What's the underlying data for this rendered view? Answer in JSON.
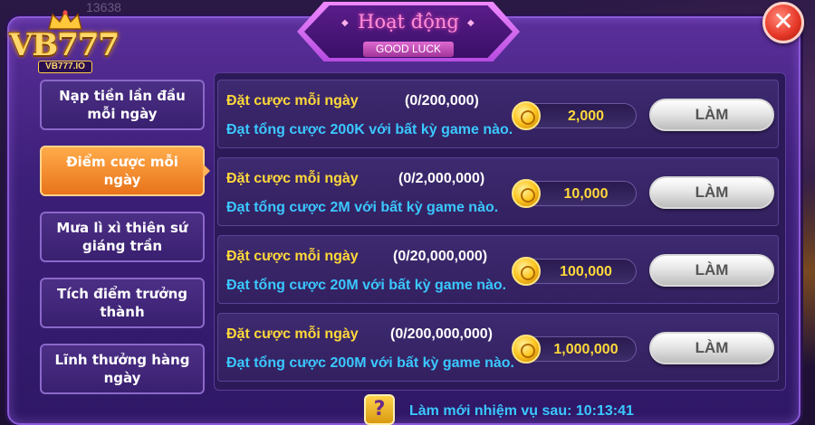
{
  "header": {
    "title": "Hoạt động",
    "subtitle": "GOOD LUCK",
    "close_label": "✕"
  },
  "logo": {
    "text": "VB777",
    "sub": "VB777.IO"
  },
  "background": {
    "top_text": "13638"
  },
  "sidebar": {
    "items": [
      {
        "label": "Nạp tiền lần đầu mỗi ngày",
        "active": false
      },
      {
        "label": "Điểm cược mỗi ngày",
        "active": true
      },
      {
        "label": "Mưa lì xì thiên sứ giáng trần",
        "active": false
      },
      {
        "label": "Tích điểm trưởng thành",
        "active": false
      },
      {
        "label": "Lĩnh thưởng hàng ngày",
        "active": false
      }
    ]
  },
  "tasks": [
    {
      "title": "Đặt cược mỗi ngày",
      "progress": "(0/200,000)",
      "desc": "Đạt tổng cược 200K với bất kỳ game nào.",
      "reward": "2,000",
      "button": "LÀM"
    },
    {
      "title": "Đặt cược mỗi ngày",
      "progress": "(0/2,000,000)",
      "desc": "Đạt tổng cược 2M với bất kỳ game nào.",
      "reward": "10,000",
      "button": "LÀM"
    },
    {
      "title": "Đặt cược mỗi ngày",
      "progress": "(0/20,000,000)",
      "desc": "Đạt tổng cược 20M với bất kỳ game nào.",
      "reward": "100,000",
      "button": "LÀM"
    },
    {
      "title": "Đặt cược mỗi ngày",
      "progress": "(0/200,000,000)",
      "desc": "Đạt tổng cược 200M với bất kỳ game nào.",
      "reward": "1,000,000",
      "button": "LÀM"
    }
  ],
  "footer": {
    "help_label": "?",
    "refresh_text": "Làm mới nhiệm vụ sau: 10:13:41"
  },
  "colors": {
    "accent_gold": "#ffd93a",
    "desc_blue": "#3ac8ff",
    "active_tab": "#e8731a",
    "panel_purple": "#3c1f78"
  }
}
